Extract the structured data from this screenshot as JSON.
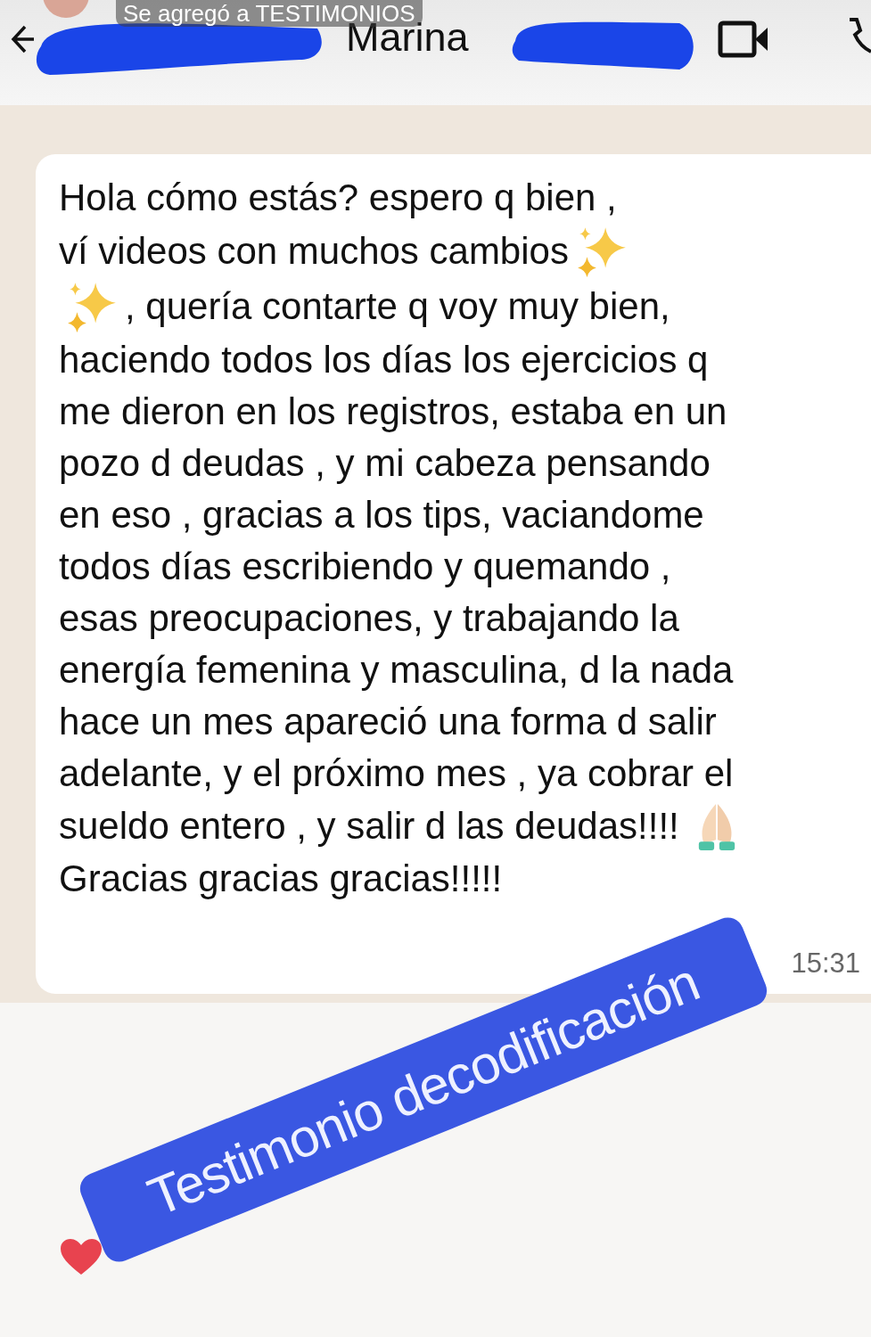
{
  "story_banner": {
    "text": "Se agregó a TESTIMONIOS"
  },
  "header": {
    "contact_name": "Marina"
  },
  "message": {
    "lines": [
      [
        {
          "kind": "text",
          "text": "Hola cómo estás? espero q bien ,"
        }
      ],
      [
        {
          "kind": "text",
          "text": "ví videos con muchos cambios"
        },
        {
          "kind": "sparkles"
        }
      ],
      [
        {
          "kind": "sparkles"
        },
        {
          "kind": "text",
          "text": ", quería contarte q voy muy bien,"
        }
      ],
      [
        {
          "kind": "text",
          "text": "haciendo todos los días los ejercicios q"
        }
      ],
      [
        {
          "kind": "text",
          "text": "me dieron en los registros, estaba en un"
        }
      ],
      [
        {
          "kind": "text",
          "text": "pozo d deudas , y mi cabeza pensando"
        }
      ],
      [
        {
          "kind": "text",
          "text": "en eso , gracias a los tips, vaciandome"
        }
      ],
      [
        {
          "kind": "text",
          "text": "todos días escribiendo y quemando ,"
        }
      ],
      [
        {
          "kind": "text",
          "text": "esas preocupaciones, y trabajando la"
        }
      ],
      [
        {
          "kind": "text",
          "text": "energía femenina y masculina, d la nada"
        }
      ],
      [
        {
          "kind": "text",
          "text": "hace un mes apareció una forma d salir"
        }
      ],
      [
        {
          "kind": "text",
          "text": "adelante, y el próximo mes , ya cobrar el"
        }
      ],
      [
        {
          "kind": "text",
          "text": "sueldo entero , y  salir d las deudas!!!!"
        },
        {
          "kind": "praying"
        }
      ],
      [
        {
          "kind": "text",
          "text": "Gracias gracias gracias!!!!!"
        }
      ]
    ],
    "time": "15:31"
  },
  "sticker": {
    "text": "Testimonio decodificación"
  }
}
